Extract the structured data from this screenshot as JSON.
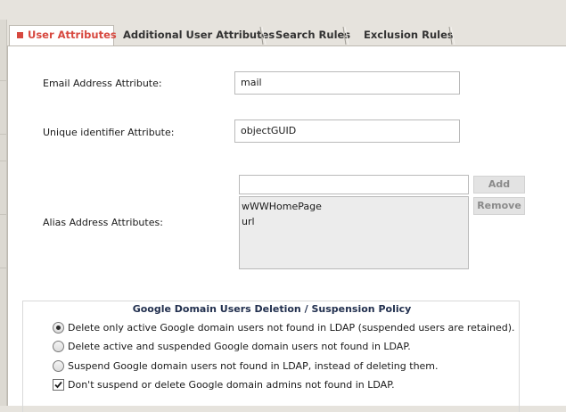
{
  "tabs": [
    {
      "label": "User Attributes",
      "active": true
    },
    {
      "label": "Additional User Attributes",
      "active": false
    },
    {
      "label": "Search Rules",
      "active": false
    },
    {
      "label": "Exclusion Rules",
      "active": false
    }
  ],
  "form": {
    "email": {
      "label": "Email Address Attribute:",
      "value": "mail"
    },
    "unique_id": {
      "label": "Unique identifier Attribute:",
      "value": "objectGUID"
    },
    "alias": {
      "label": "Alias Address Attributes:",
      "input_value": "",
      "add_label": "Add",
      "remove_label": "Remove",
      "items": [
        "wWWHomePage",
        "url"
      ]
    }
  },
  "policy": {
    "title": "Google Domain Users Deletion / Suspension Policy",
    "options": [
      {
        "type": "radio",
        "selected": true,
        "label": "Delete only active Google domain users not found in LDAP (suspended users are retained)."
      },
      {
        "type": "radio",
        "selected": false,
        "label": "Delete active and suspended Google domain users not found in LDAP."
      },
      {
        "type": "radio",
        "selected": false,
        "label": "Suspend Google domain users not found in LDAP, instead of deleting them."
      },
      {
        "type": "checkbox",
        "checked": true,
        "label": "Don't suspend or delete Google domain admins not found in LDAP."
      }
    ]
  },
  "colors": {
    "accent": "#d7483f",
    "policy_title": "#22304f"
  }
}
